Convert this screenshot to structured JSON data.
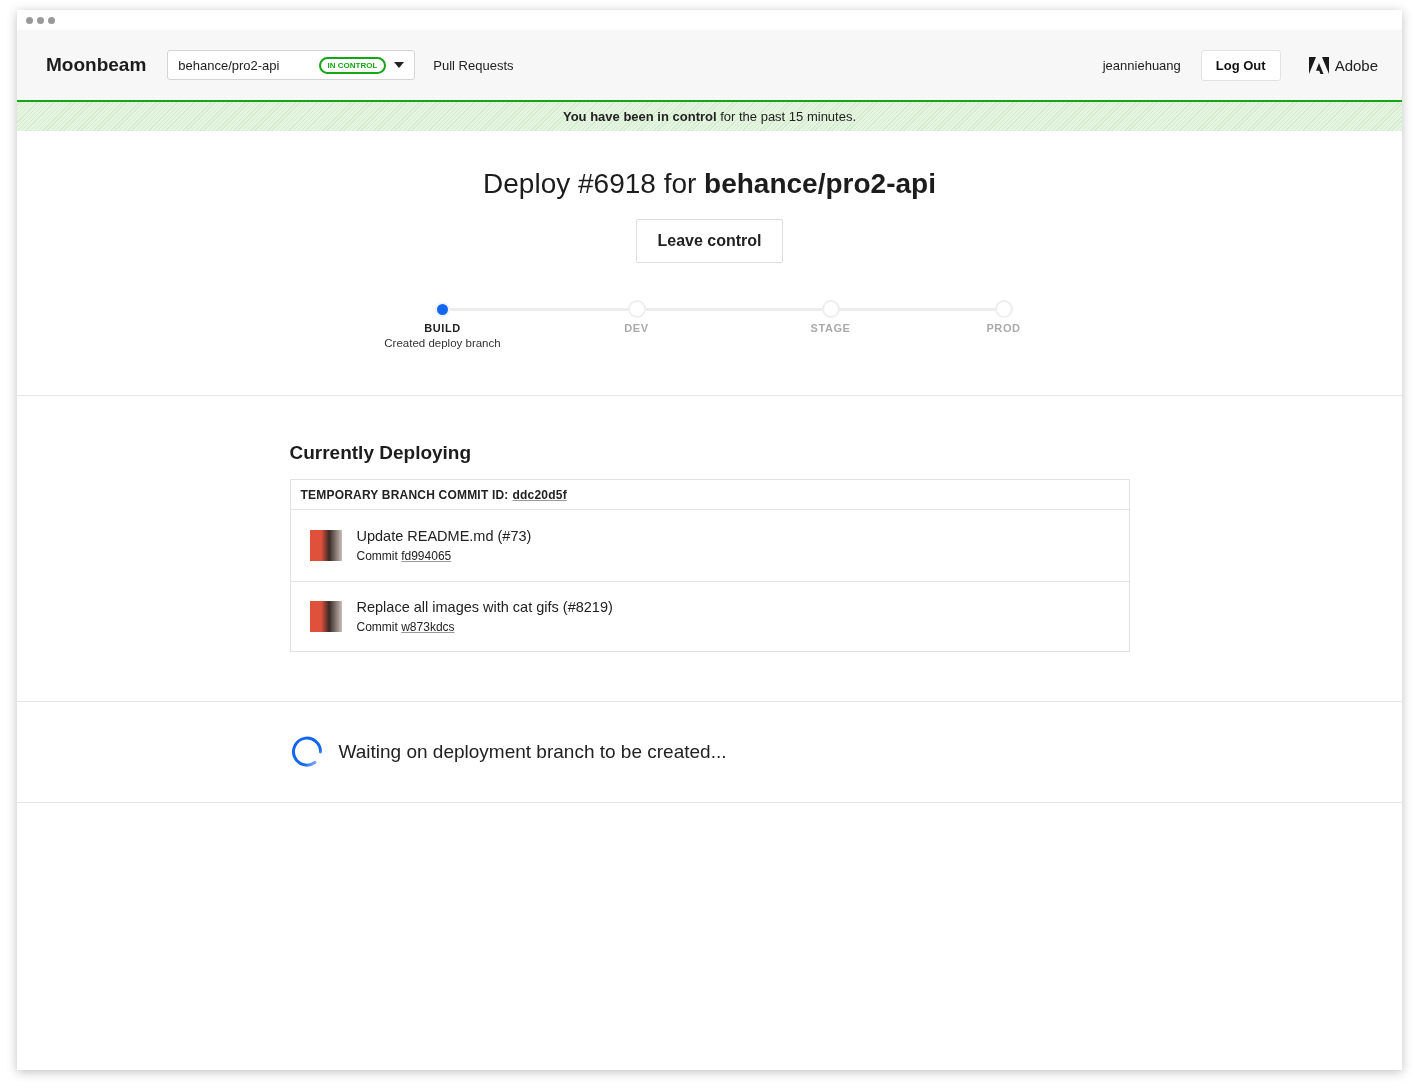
{
  "header": {
    "app_name": "Moonbeam",
    "repo_picker": {
      "value": "behance/pro2-api",
      "badge": "IN CONTROL"
    },
    "nav": [
      {
        "label": "Pull Requests"
      }
    ],
    "user": "jeanniehuang",
    "logout": "Log Out",
    "brand": "Adobe"
  },
  "banner": "**You have been in control** for the past 15 minutes.",
  "deploy": {
    "title": "Deploy #6918 for **behance/pro2-api**",
    "button": "Leave control"
  },
  "stages": [
    {
      "label": "BUILD",
      "detail": "Created deploy branch",
      "selected": true
    },
    {
      "label": "DEV",
      "selected": false
    },
    {
      "label": "STAGE",
      "selected": false
    },
    {
      "label": "PROD",
      "selected": false
    }
  ],
  "currently_deploying": {
    "heading": "Currently Deploying",
    "commit_label": "TEMPORARY BRANCH COMMIT ID:",
    "commit_id": "ddc20d5f",
    "commits": [
      {
        "title": "Update README.md (#73)",
        "label": "Commit",
        "hash": "fd994065"
      },
      {
        "title": "Replace all images with cat gifs (#8219)",
        "label": "Commit",
        "hash": "w873kdcs"
      }
    ]
  },
  "status": "Waiting on deployment branch to be created..."
}
